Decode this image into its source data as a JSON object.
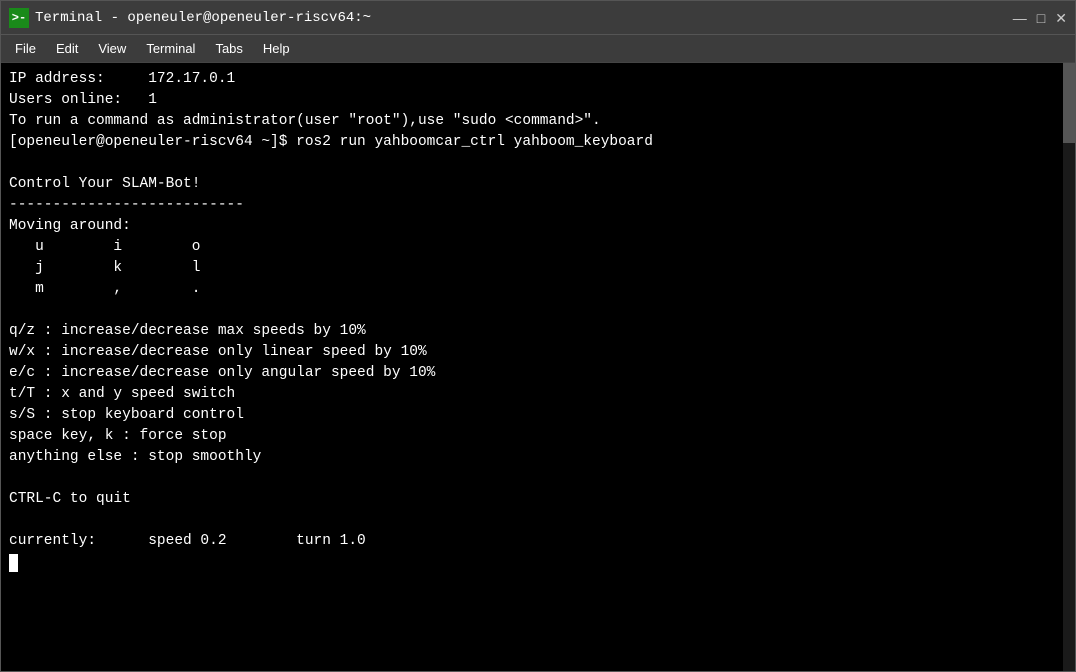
{
  "window": {
    "title": "Terminal - openeuler@openeuler-riscv64:~",
    "icon_label": ">-"
  },
  "titlebar": {
    "controls": {
      "minimize": "—",
      "maximize": "□",
      "close": "✕"
    }
  },
  "menubar": {
    "items": [
      {
        "label": "File"
      },
      {
        "label": "Edit"
      },
      {
        "label": "View"
      },
      {
        "label": "Terminal"
      },
      {
        "label": "Tabs"
      },
      {
        "label": "Help"
      }
    ]
  },
  "terminal": {
    "lines": [
      "IP address:     172.17.0.1",
      "Users online:   1",
      "To run a command as administrator(user \"root\"),use \"sudo <command>\".",
      "[openeuler@openeuler-riscv64 ~]$ ros2 run yahboomcar_ctrl yahboom_keyboard",
      "",
      "Control Your SLAM-Bot!",
      "---------------------------",
      "Moving around:",
      "   u        i        o",
      "   j        k        l",
      "   m        ,        .",
      "",
      "q/z : increase/decrease max speeds by 10%",
      "w/x : increase/decrease only linear speed by 10%",
      "e/c : increase/decrease only angular speed by 10%",
      "t/T : x and y speed switch",
      "s/S : stop keyboard control",
      "space key, k : force stop",
      "anything else : stop smoothly",
      "",
      "CTRL-C to quit",
      "",
      "currently:      speed 0.2        turn 1.0"
    ]
  }
}
